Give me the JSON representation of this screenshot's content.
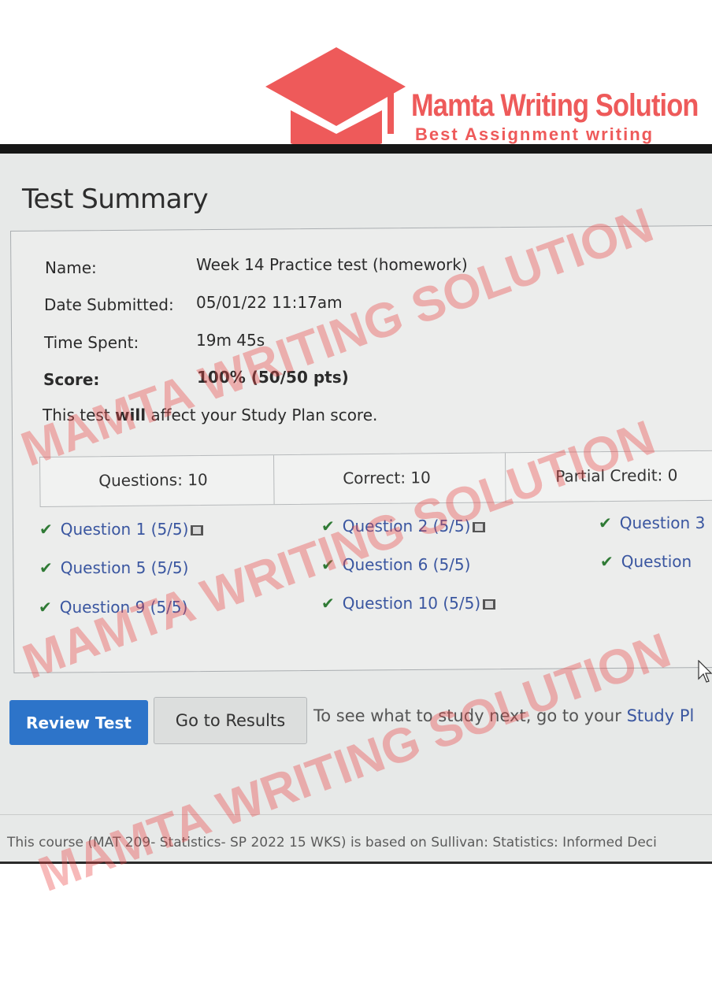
{
  "brand": {
    "title": "Mamta Writing Solution",
    "subtitle": "Best Assignment writing",
    "watermark": "MAMTA WRITING SOLUTION",
    "color": "#ee5a5a"
  },
  "page": {
    "title": "Test Summary"
  },
  "summary": {
    "name_label": "Name:",
    "name_value": "Week 14 Practice test (homework)",
    "date_label": "Date Submitted:",
    "date_value": "05/01/22 11:17am",
    "time_label": "Time Spent:",
    "time_value": "19m 45s",
    "score_label": "Score:",
    "score_value": "100% (50/50 pts)",
    "affect_prefix": "This test ",
    "affect_bold": "will",
    "affect_suffix": " affect your Study Plan score."
  },
  "stats": {
    "questions": "Questions: 10",
    "correct": "Correct: 10",
    "partial": "Partial Credit: 0"
  },
  "questions": [
    {
      "label": "Question 1 (5/5)",
      "status": "correct",
      "has_media": true
    },
    {
      "label": "Question 2 (5/5)",
      "status": "correct",
      "has_media": true
    },
    {
      "label": "Question 3",
      "status": "correct",
      "has_media": false
    },
    {
      "label": "Question 5 (5/5)",
      "status": "correct",
      "has_media": false
    },
    {
      "label": "Question 6 (5/5)",
      "status": "correct",
      "has_media": false
    },
    {
      "label": "Question",
      "status": "correct",
      "has_media": false
    },
    {
      "label": "Question 9 (5/5)",
      "status": "correct",
      "has_media": false
    },
    {
      "label": "Question 10 (5/5)",
      "status": "correct",
      "has_media": true
    }
  ],
  "actions": {
    "review": "Review Test",
    "results": "Go to Results",
    "next_text": "To see what to study next, go to your ",
    "next_link": "Study Pl"
  },
  "footer": {
    "text": "This course (MAT 209- Statistics- SP 2022 15 WKS) is based on Sullivan: Statistics: Informed Deci"
  },
  "icons": {
    "check": "checkmark-icon",
    "media": "film-icon",
    "cursor": "mouse-pointer-icon"
  },
  "colors": {
    "primary_button": "#2d74c9",
    "link": "#3a56a0",
    "check": "#2f7a35"
  }
}
